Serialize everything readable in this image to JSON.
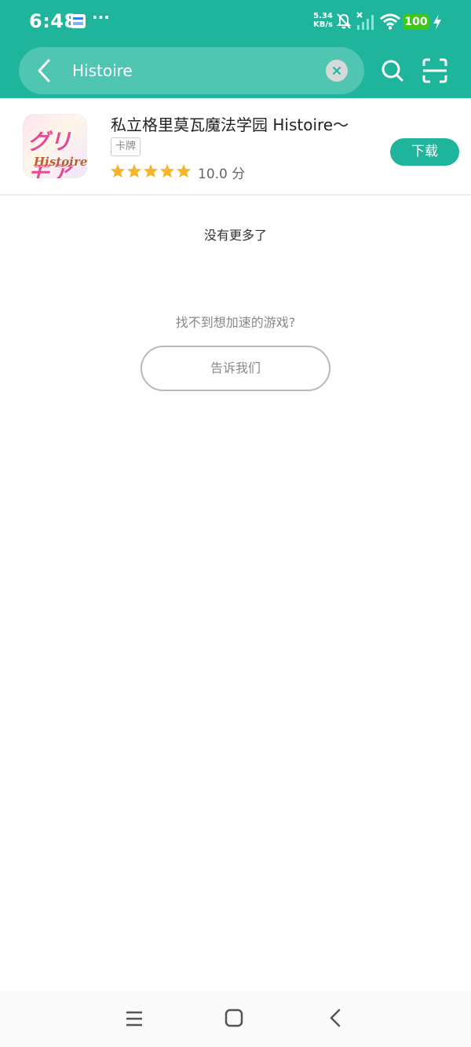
{
  "status_bar": {
    "time": "6:48",
    "more": "···",
    "net_speed_value": "5.34",
    "net_speed_unit": "KB/s",
    "battery": "100"
  },
  "search": {
    "query": "Histoire",
    "icons": [
      "back-arrow-icon",
      "clear-icon",
      "search-icon",
      "scan-icon"
    ]
  },
  "result": {
    "title": "私立格里莫瓦魔法学园 Histoire～",
    "tag": "卡牌",
    "rating_stars": 5,
    "score": "10.0 分",
    "download_label": "下载",
    "icon_text_top": "グリモア",
    "icon_text_bottom": "Histoire"
  },
  "footer": {
    "no_more": "没有更多了",
    "prompt": "找不到想加速的游戏?",
    "tell_us_label": "告诉我们"
  },
  "colors": {
    "accent": "#1fb59c",
    "star": "#f7b52c",
    "battery": "#3ec51e"
  }
}
